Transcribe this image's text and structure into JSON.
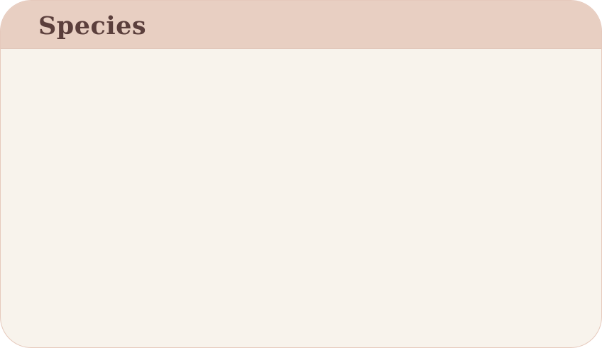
{
  "card": {
    "title": "Species"
  },
  "colors": {
    "header_bg": "#e8cfc2",
    "body_bg": "#f8f3ec",
    "title_text": "#5b3f3c",
    "border": "#e6c9bc"
  }
}
